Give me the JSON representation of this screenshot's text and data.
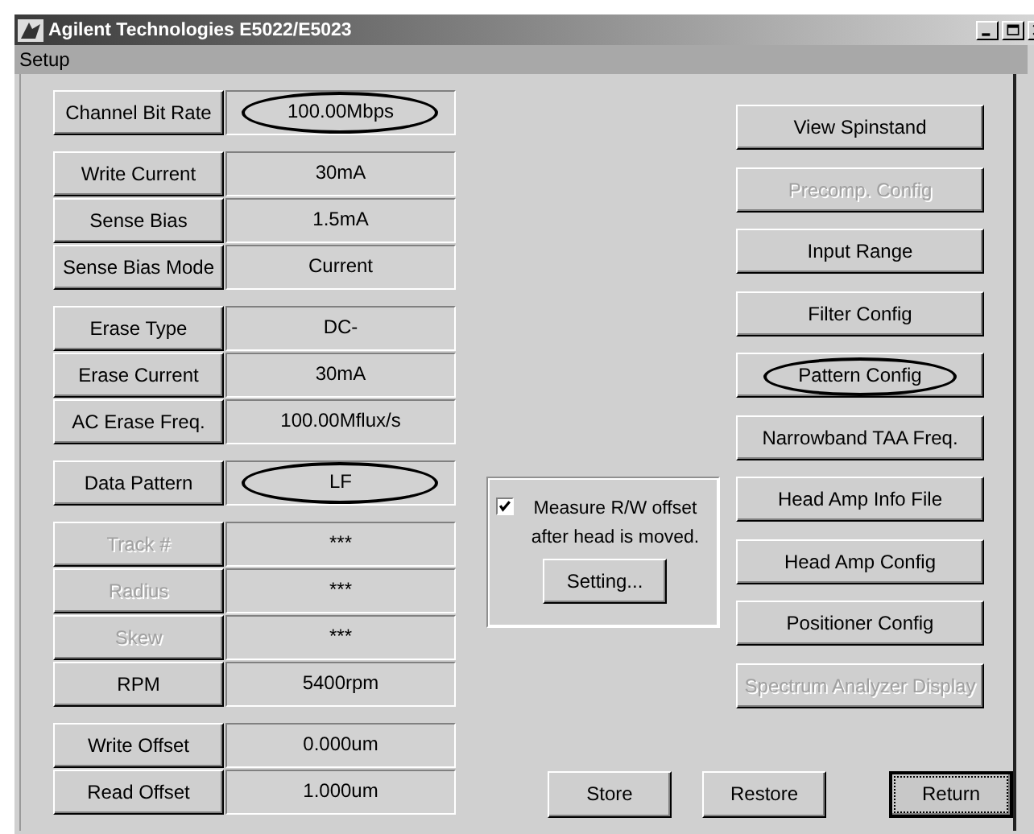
{
  "window": {
    "title": "Agilent Technologies E5022/E5023"
  },
  "menu": [
    "Setup"
  ],
  "parameter_groups": [
    [
      {
        "label": "Channel Bit Rate",
        "value": "100.00Mbps",
        "disabled": false,
        "circled": true
      }
    ],
    [
      {
        "label": "Write Current",
        "value": "30mA",
        "disabled": false,
        "circled": false
      },
      {
        "label": "Sense Bias",
        "value": "1.5mA",
        "disabled": false,
        "circled": false
      },
      {
        "label": "Sense Bias Mode",
        "value": "Current",
        "disabled": false,
        "circled": false
      }
    ],
    [
      {
        "label": "Erase Type",
        "value": "DC-",
        "disabled": false,
        "circled": false
      },
      {
        "label": "Erase Current",
        "value": "30mA",
        "disabled": false,
        "circled": false
      },
      {
        "label": "AC Erase Freq.",
        "value": "100.00Mflux/s",
        "disabled": false,
        "circled": false
      }
    ],
    [
      {
        "label": "Data Pattern",
        "value": "LF",
        "disabled": false,
        "circled": true
      }
    ],
    [
      {
        "label": "Track #",
        "value": "***",
        "disabled": true,
        "circled": false
      },
      {
        "label": "Radius",
        "value": "***",
        "disabled": true,
        "circled": false
      },
      {
        "label": "Skew",
        "value": "***",
        "disabled": true,
        "circled": false
      },
      {
        "label": "RPM",
        "value": "5400rpm",
        "disabled": false,
        "circled": false
      }
    ],
    [
      {
        "label": "Write Offset",
        "value": "0.000um",
        "disabled": false,
        "circled": false
      },
      {
        "label": "Read Offset",
        "value": "1.000um",
        "disabled": false,
        "circled": false
      }
    ]
  ],
  "measure_box": {
    "checkbox": {
      "label": "Measure R/W offset after head is moved.",
      "checked": true
    },
    "button": "Setting..."
  },
  "side_buttons": [
    {
      "label": "View Spinstand",
      "disabled": false,
      "circled": false
    },
    {
      "label": "Precomp. Config",
      "disabled": true,
      "circled": false
    },
    {
      "label": "Input Range",
      "disabled": false,
      "circled": false
    },
    {
      "label": "Filter Config",
      "disabled": false,
      "circled": false
    },
    {
      "label": "Pattern Config",
      "disabled": false,
      "circled": true
    },
    {
      "label": "Narrowband TAA Freq.",
      "disabled": false,
      "circled": false
    },
    {
      "label": "Head Amp Info File",
      "disabled": false,
      "circled": false
    },
    {
      "label": "Head Amp Config",
      "disabled": false,
      "circled": false
    },
    {
      "label": "Positioner Config",
      "disabled": false,
      "circled": false
    },
    {
      "label": "Spectrum Analyzer Display",
      "disabled": true,
      "circled": false
    }
  ],
  "footer_buttons": [
    {
      "label": "Store",
      "focused": false
    },
    {
      "label": "Restore",
      "focused": false
    },
    {
      "label": "Return",
      "focused": true
    }
  ]
}
